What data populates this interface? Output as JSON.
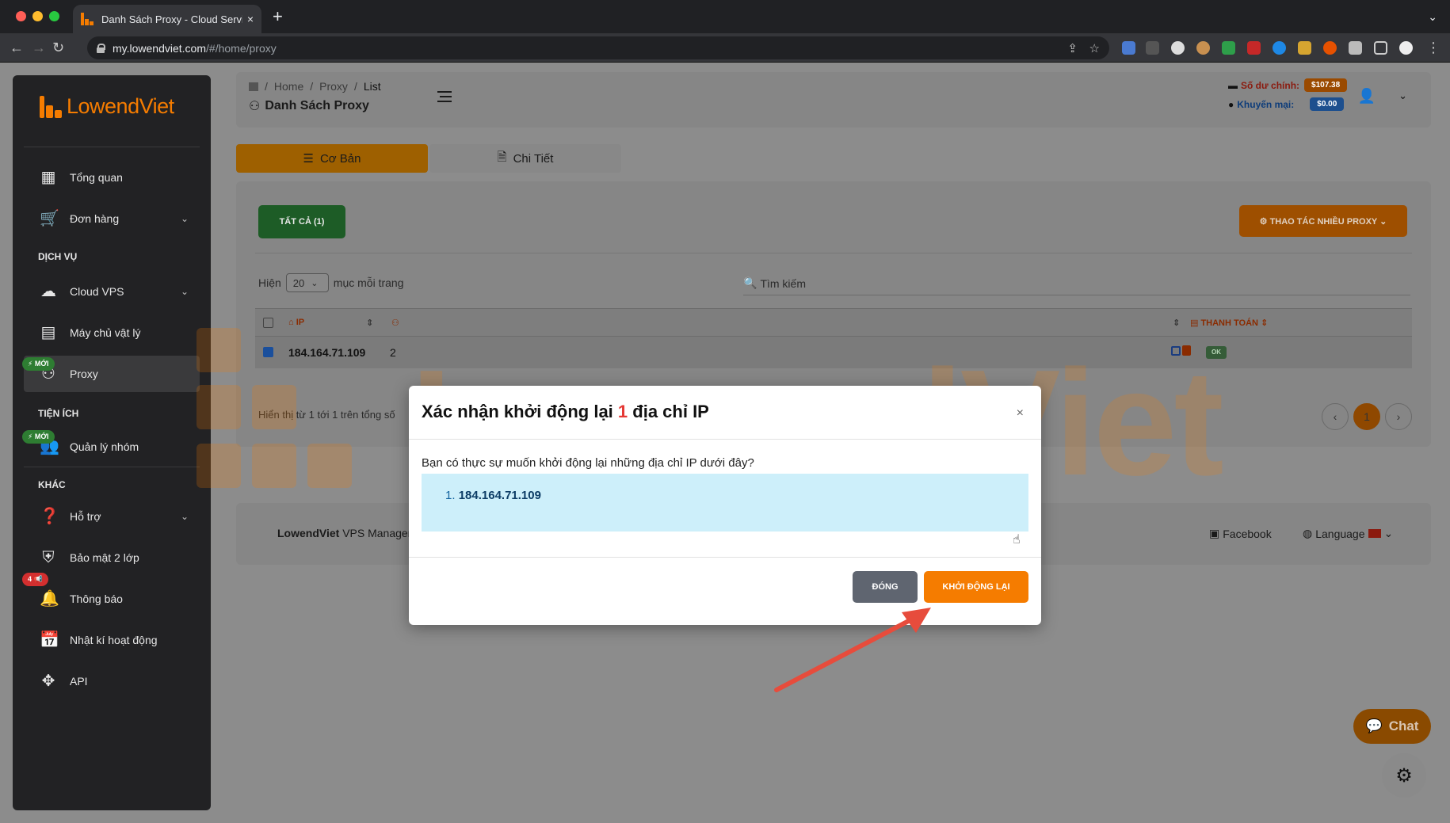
{
  "browser": {
    "tab_title": "Danh Sách Proxy - Cloud Servi",
    "url_host": "my.lowendviet.com",
    "url_path": "/#/home/proxy",
    "new_tab": "+",
    "tab_close": "×"
  },
  "brand": {
    "name": "LowendViet",
    "name_a": "Lowend",
    "name_b": "Viet",
    "accent": "#f57c00"
  },
  "sidebar": {
    "items": [
      {
        "key": "overview",
        "label": "Tổng quan",
        "icon": "dashboard-icon"
      },
      {
        "key": "orders",
        "label": "Đơn hàng",
        "icon": "cart-icon"
      },
      {
        "key": "cloud-vps",
        "label": "Cloud VPS",
        "icon": "cloud-icon"
      },
      {
        "key": "dedicated",
        "label": "Máy chủ vật lý",
        "icon": "server-icon"
      },
      {
        "key": "proxy",
        "label": "Proxy",
        "icon": "network-icon"
      },
      {
        "key": "groups",
        "label": "Quản lý nhóm",
        "icon": "group-icon"
      },
      {
        "key": "support",
        "label": "Hỗ trợ",
        "icon": "help-icon"
      },
      {
        "key": "2fa",
        "label": "Bảo mật 2 lớp",
        "icon": "shield-icon"
      },
      {
        "key": "notify",
        "label": "Thông báo",
        "icon": "bell-icon"
      },
      {
        "key": "log",
        "label": "Nhật kí hoạt động",
        "icon": "calendar-icon"
      },
      {
        "key": "api",
        "label": "API",
        "icon": "api-icon"
      }
    ],
    "sections": {
      "services": "DỊCH VỤ",
      "utilities": "TIỆN ÍCH",
      "other": "KHÁC"
    },
    "badge_new": "⚡ MỚI",
    "badge_notify": "4 📢"
  },
  "header": {
    "breadcrumb": [
      "Home",
      "Proxy",
      "List"
    ],
    "title": "Danh Sách Proxy",
    "main_balance_label": "Số dư chính:",
    "main_balance": "$107.38",
    "promo_label": "Khuyến mại:",
    "promo_balance": "$0.00"
  },
  "tabs": {
    "basic": "Cơ Bản",
    "detail": "Chi Tiết"
  },
  "toolbar": {
    "all_label": "TẤT CẢ (1)",
    "bulk_label": "⚙ THAO TÁC NHIỀU PROXY ⌄"
  },
  "list": {
    "show_prefix": "Hiện",
    "page_size": "20",
    "show_suffix": "mục mỗi trang",
    "search_placeholder": "Tìm kiếm",
    "col_ip": "IP",
    "col_payment": "THANH TOÁN",
    "rows": [
      {
        "ip": "184.164.71.109",
        "count": "2",
        "status": "OK"
      }
    ],
    "info": "Hiển thị từ 1 tới 1 trên tổng số",
    "current_page": "1",
    "prev": "‹",
    "next": "›"
  },
  "footer": {
    "brand": "LowendViet",
    "product": " VPS Manager",
    "facebook": "Facebook",
    "language": "Language"
  },
  "chat": {
    "label": "Chat"
  },
  "modal": {
    "title_before": "Xác nhận khởi động lại ",
    "title_count": "1",
    "title_after": " địa chỉ IP",
    "close_x": "×",
    "question": "Bạn có thực sự muốn khởi động lại những địa chỉ IP dưới đây?",
    "item_index": "1.",
    "item_ip": "184.164.71.109",
    "btn_close": "ĐÓNG",
    "btn_restart": "KHỞI ĐỘNG LẠI"
  }
}
